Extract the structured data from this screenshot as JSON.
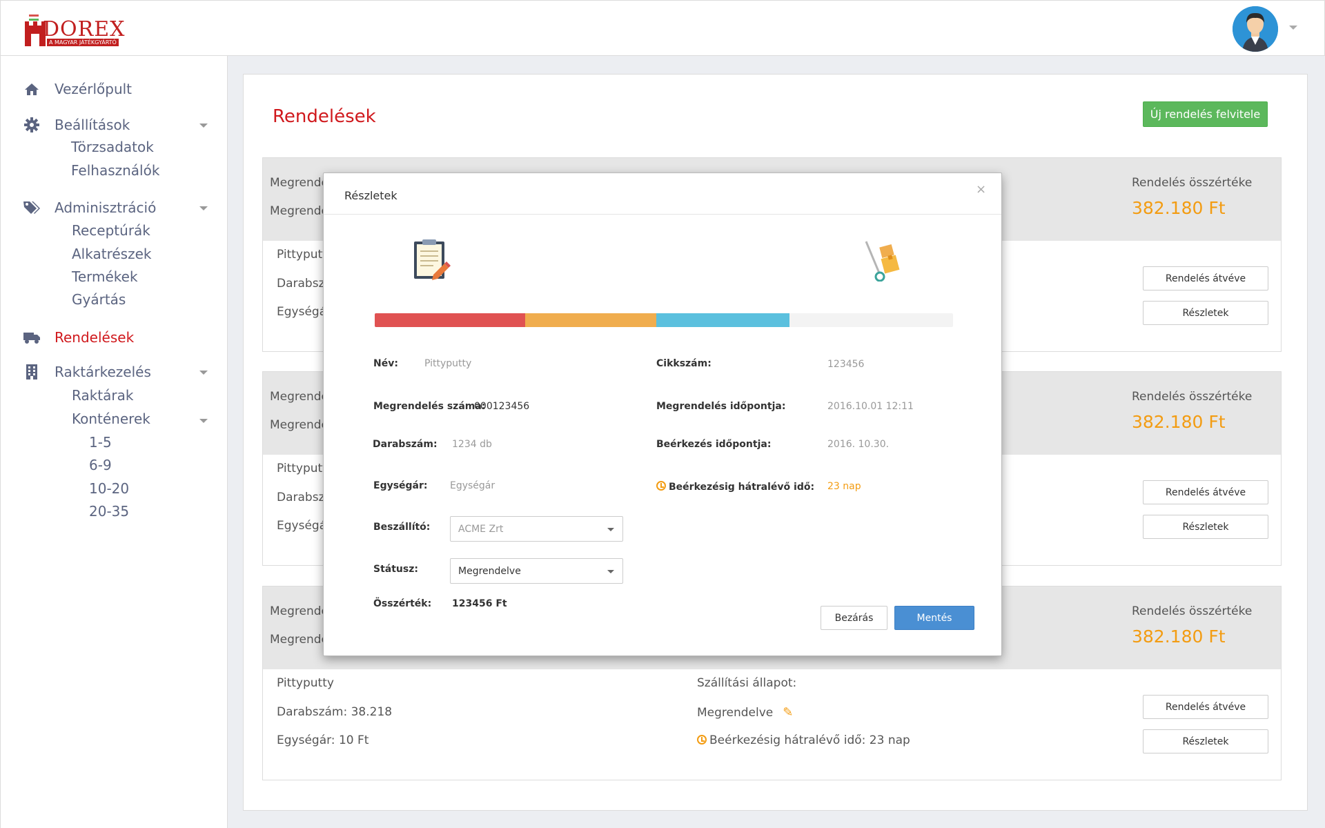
{
  "logo": {
    "text": "DOREX",
    "subtitle": "A MAGYAR JÁTÉKGYÁRTÓ"
  },
  "sidebar": {
    "dashboard": "Vezérlőpult",
    "settings": {
      "label": "Beállítások",
      "items": [
        "Törzsadatok",
        "Felhasználók"
      ]
    },
    "admin": {
      "label": "Adminisztráció",
      "items": [
        "Receptúrák",
        "Alkatrészek",
        "Termékek",
        "Gyártás"
      ]
    },
    "orders": "Rendelések",
    "warehouse": {
      "label": "Raktárkezelés",
      "items": [
        "Raktárak",
        "Konténerek"
      ],
      "containers": [
        "1-5",
        "6-9",
        "10-20",
        "20-35"
      ]
    }
  },
  "page": {
    "title": "Rendelések",
    "new_button": "Új rendelés felvitele"
  },
  "orders": [
    {
      "head_1": "Megrende",
      "head_2": "Megrende",
      "total_label": "Rendelés összértéke",
      "total_value": "382.180 Ft",
      "product": "Pittyputt",
      "qty": "Darabsz",
      "unit_price": "Egységár",
      "received_btn": "Rendelés átvéve",
      "details_btn": "Részletek"
    },
    {
      "head_1": "Megrende",
      "head_2": "Megrende",
      "total_label": "Rendelés összértéke",
      "total_value": "382.180 Ft",
      "product": "Pittyputt",
      "qty": "Darabsz",
      "unit_price": "Egységár",
      "received_btn": "Rendelés átvéve",
      "details_btn": "Részletek"
    },
    {
      "head_1": "Megrende",
      "head_2": "Megrende",
      "total_label": "Rendelés összértéke",
      "total_value": "382.180 Ft",
      "product": "Pittyputty",
      "qty": "Darabszám: 38.218",
      "unit_price": "Egységár: 10 Ft",
      "shipping_label": "Szállítási állapot:",
      "shipping_status": "Megrendelve",
      "remaining": "Beérkezésig hátralévő idő: 23 nap",
      "received_btn": "Rendelés átvéve",
      "details_btn": "Részletek"
    }
  ],
  "modal": {
    "title": "Részletek",
    "close": "×",
    "progress": [
      {
        "fraction": 0.26,
        "color": "#e05252"
      },
      {
        "fraction": 0.227,
        "color": "#f0ad4e"
      },
      {
        "fraction": 0.23,
        "color": "#5bc0de"
      }
    ],
    "name_label": "Név:",
    "name_value": "Pittyputty",
    "sku_label": "Cikkszám:",
    "sku_value": "123456",
    "order_no_label": "Megrendelés száma:",
    "order_no_value": "000123456",
    "order_time_label": "Megrendelés időpontja:",
    "order_time_value": "2016.10.01 12:11",
    "qty_label": "Darabszám:",
    "qty_value": "1234 db",
    "arrival_label": "Beérkezés időpontja:",
    "arrival_value": "2016. 10.30.",
    "unit_label": "Egységár:",
    "unit_value": "Egységár",
    "remaining_label": "Beérkezésig hátralévő idő:",
    "remaining_value": "23 nap",
    "supplier_label": "Beszállító:",
    "supplier_value": "ACME Zrt",
    "status_label": "Státusz:",
    "status_value": "Megrendelve",
    "total_label": "Összérték:",
    "total_value": "123456 Ft",
    "close_btn": "Bezárás",
    "save_btn": "Mentés"
  }
}
